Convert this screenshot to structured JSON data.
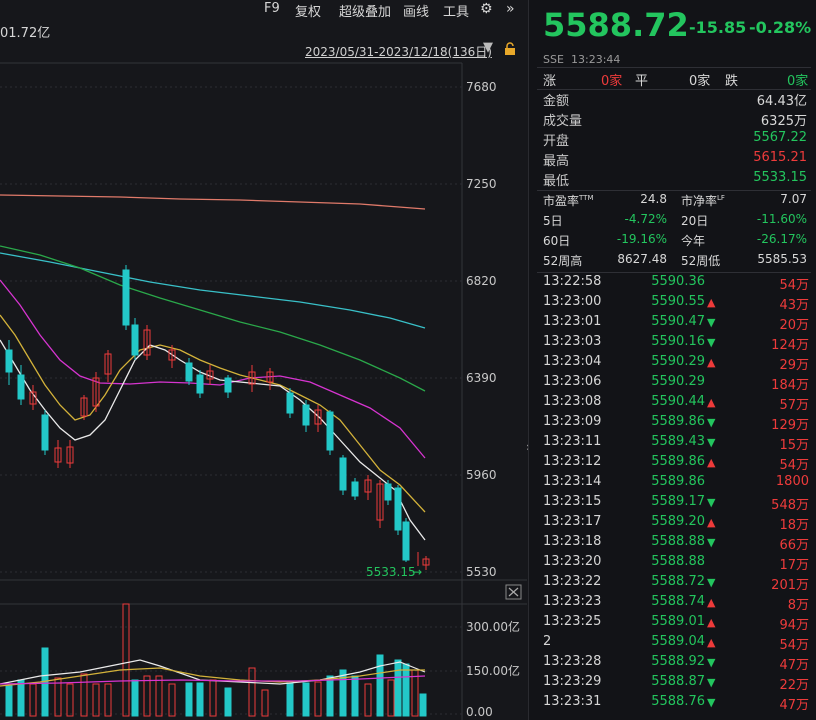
{
  "toolbar": {
    "items": [
      "F9",
      "复权",
      "超级叠加",
      "画线",
      "工具"
    ],
    "amount_fragment": "01.72亿",
    "date_range": "2023/05/31-2023/12/18(136日)"
  },
  "kline": {
    "y_ticks": [
      "7680",
      "7250",
      "6820",
      "6390",
      "5960",
      "5530"
    ],
    "low_label": "5533.15",
    "volume_ticks": [
      "300.00亿",
      "150.00亿",
      "0.00"
    ]
  },
  "colors": {
    "up": "#ee3b3b",
    "down": "#23c8c8",
    "green": "#23c55e"
  },
  "quote": {
    "price": "5588.72",
    "change": "-15.85",
    "change_pct": "-0.28%",
    "exchange": "SSE",
    "time": "13:23:44",
    "breadth": {
      "up_label": "涨",
      "up_val": "0家",
      "flat_label": "平",
      "flat_val": "0家",
      "down_label": "跌",
      "down_val": "0家"
    },
    "stats": [
      {
        "label": "金额",
        "value": "64.43亿",
        "color": "white"
      },
      {
        "label": "成交量",
        "value": "6325万",
        "color": "white"
      },
      {
        "label": "开盘",
        "value": "5567.22",
        "color": "green"
      },
      {
        "label": "最高",
        "value": "5615.21",
        "color": "red"
      },
      {
        "label": "最低",
        "value": "5533.15",
        "color": "green"
      }
    ],
    "metrics": [
      {
        "l1": "市盈率TTM",
        "v1": "24.8",
        "c1": "white",
        "l2": "市净率LF",
        "v2": "7.07",
        "c2": "white"
      },
      {
        "l1": "5日",
        "v1": "-4.72%",
        "c1": "green",
        "l2": "20日",
        "v2": "-11.60%",
        "c2": "green"
      },
      {
        "l1": "60日",
        "v1": "-19.16%",
        "c1": "green",
        "l2": "今年",
        "v2": "-26.17%",
        "c2": "green"
      },
      {
        "l1": "52周高",
        "v1": "8627.48",
        "c1": "white",
        "l2": "52周低",
        "v2": "5585.53",
        "c2": "white"
      }
    ]
  },
  "ticks": [
    {
      "time": "13:22:58",
      "price": "5590.36",
      "dir": "",
      "vol": "54万",
      "vc": "red"
    },
    {
      "time": "13:23:00",
      "price": "5590.55",
      "dir": "up",
      "vol": "43万",
      "vc": "red"
    },
    {
      "time": "13:23:01",
      "price": "5590.47",
      "dir": "down",
      "vol": "20万",
      "vc": "red"
    },
    {
      "time": "13:23:03",
      "price": "5590.16",
      "dir": "down",
      "vol": "124万",
      "vc": "red"
    },
    {
      "time": "13:23:04",
      "price": "5590.29",
      "dir": "up",
      "vol": "29万",
      "vc": "red"
    },
    {
      "time": "13:23:06",
      "price": "5590.29",
      "dir": "",
      "vol": "184万",
      "vc": "red"
    },
    {
      "time": "13:23:08",
      "price": "5590.44",
      "dir": "up",
      "vol": "57万",
      "vc": "red"
    },
    {
      "time": "13:23:09",
      "price": "5589.86",
      "dir": "down",
      "vol": "129万",
      "vc": "red"
    },
    {
      "time": "13:23:11",
      "price": "5589.43",
      "dir": "down",
      "vol": "15万",
      "vc": "red"
    },
    {
      "time": "13:23:12",
      "price": "5589.86",
      "dir": "up",
      "vol": "54万",
      "vc": "red"
    },
    {
      "time": "13:23:14",
      "price": "5589.86",
      "dir": "",
      "vol": "1800",
      "vc": "red"
    },
    {
      "time": "13:23:15",
      "price": "5589.17",
      "dir": "down",
      "vol": "548万",
      "vc": "red"
    },
    {
      "time": "13:23:17",
      "price": "5589.20",
      "dir": "up",
      "vol": "18万",
      "vc": "red"
    },
    {
      "time": "13:23:18",
      "price": "5588.88",
      "dir": "down",
      "vol": "66万",
      "vc": "red"
    },
    {
      "time": "13:23:20",
      "price": "5588.88",
      "dir": "",
      "vol": "17万",
      "vc": "red"
    },
    {
      "time": "13:23:22",
      "price": "5588.72",
      "dir": "down",
      "vol": "201万",
      "vc": "red"
    },
    {
      "time": "13:23:23",
      "price": "5588.74",
      "dir": "up",
      "vol": "8万",
      "vc": "red"
    },
    {
      "time": "13:23:25",
      "price": "5589.01",
      "dir": "up",
      "vol": "94万",
      "vc": "red"
    },
    {
      "time": "2",
      "price": "5589.04",
      "dir": "up",
      "vol": "54万",
      "vc": "red"
    },
    {
      "time": "13:23:28",
      "price": "5588.92",
      "dir": "down",
      "vol": "47万",
      "vc": "red"
    },
    {
      "time": "13:23:29",
      "price": "5588.87",
      "dir": "down",
      "vol": "22万",
      "vc": "red"
    },
    {
      "time": "13:23:31",
      "price": "5588.76",
      "dir": "down",
      "vol": "47万",
      "vc": "red"
    }
  ]
}
